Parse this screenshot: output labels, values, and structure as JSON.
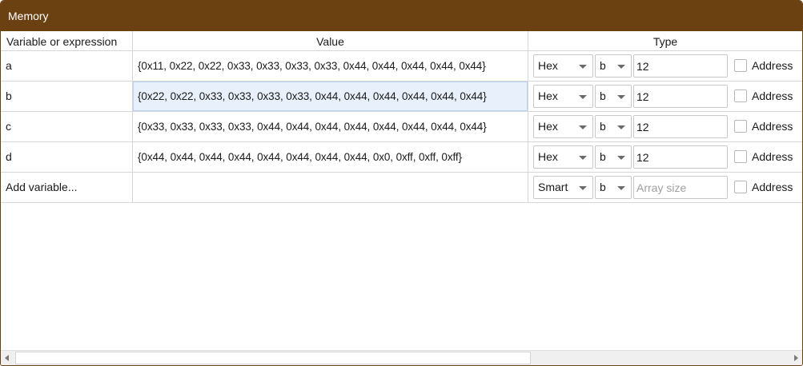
{
  "window": {
    "title": "Memory",
    "title_bg_color": "#6b4112"
  },
  "columns": {
    "variable": "Variable or expression",
    "value": "Value",
    "type": "Type"
  },
  "rows": [
    {
      "variable": "a",
      "value": "{0x11, 0x22, 0x22, 0x33, 0x33, 0x33, 0x33, 0x44, 0x44, 0x44, 0x44, 0x44}",
      "format": "Hex",
      "size": "b",
      "array_size": "12",
      "address_label": "Address",
      "address_checked": false
    },
    {
      "variable": "b",
      "value": "{0x22, 0x22, 0x33, 0x33, 0x33, 0x33, 0x44, 0x44, 0x44, 0x44, 0x44, 0x44}",
      "format": "Hex",
      "size": "b",
      "array_size": "12",
      "address_label": "Address",
      "address_checked": false
    },
    {
      "variable": "c",
      "value": "{0x33, 0x33, 0x33, 0x33, 0x44, 0x44, 0x44, 0x44, 0x44, 0x44, 0x44, 0x44}",
      "format": "Hex",
      "size": "b",
      "array_size": "12",
      "address_label": "Address",
      "address_checked": false
    },
    {
      "variable": "d",
      "value": "{0x44, 0x44, 0x44, 0x44, 0x44, 0x44, 0x44, 0x44, 0x0, 0xff, 0xff, 0xff}",
      "format": "Hex",
      "size": "b",
      "array_size": "12",
      "address_label": "Address",
      "address_checked": false
    }
  ],
  "add_row": {
    "variable": "Add variable...",
    "format": "Smart",
    "size": "b",
    "array_size_placeholder": "Array size",
    "address_label": "Address"
  },
  "selected_row_index": 1,
  "icons": {
    "dropdown": "chevron-down-icon",
    "scroll_left": "scroll-left-arrow-icon",
    "scroll_right": "scroll-right-arrow-icon"
  }
}
